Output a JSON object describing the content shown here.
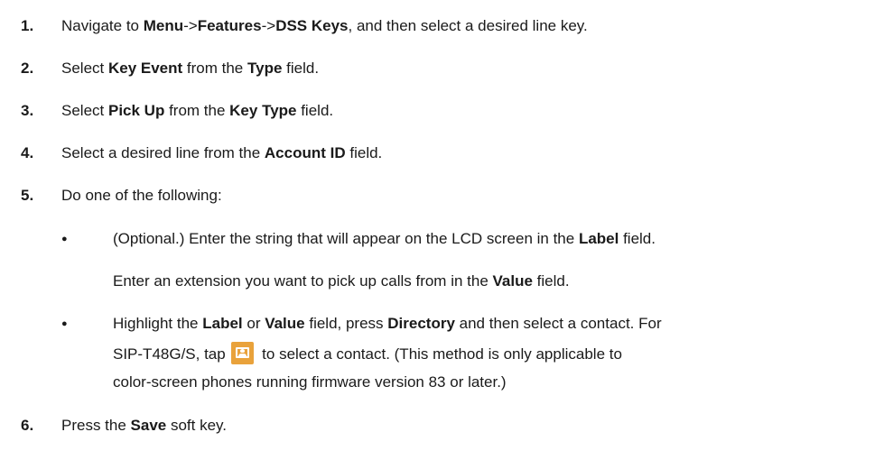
{
  "steps": [
    {
      "num": "1.",
      "parts": [
        "Navigate to ",
        "Menu",
        "->",
        "Features",
        "->",
        "DSS Keys",
        ", and then select a desired line key."
      ]
    },
    {
      "num": "2.",
      "parts": [
        "Select ",
        "Key Event",
        " from the ",
        "Type",
        " field."
      ]
    },
    {
      "num": "3.",
      "parts": [
        "Select ",
        "Pick Up",
        " from the ",
        "Key Type",
        " field."
      ]
    },
    {
      "num": "4.",
      "parts": [
        "Select a desired line from the ",
        "Account ID",
        " field."
      ]
    },
    {
      "num": "5.",
      "parts": [
        "Do one of the following:"
      ]
    },
    {
      "num": "6.",
      "parts": [
        "Press the ",
        "Save",
        " soft key."
      ]
    }
  ],
  "bullets": [
    {
      "bullet": "●",
      "line1": [
        "(Optional.) Enter the string that will appear on the LCD screen in the ",
        "Label",
        " field."
      ],
      "line2": [
        "Enter an extension you want to pick up calls from in the ",
        "Value",
        " field."
      ]
    },
    {
      "bullet": "●",
      "line1": [
        "Highlight the ",
        "Label",
        " or ",
        "Value",
        " field, press ",
        "Directory",
        " and then select a contact. For"
      ],
      "line2": [
        "SIP-T48G/S, tap ",
        " to select a contact. (This method is only applicable to"
      ],
      "line3": [
        "color-screen phones running firmware version 83 or later.)"
      ]
    }
  ],
  "icons": {
    "contact": "contacts-icon",
    "contact_color": "#e9a23b"
  }
}
